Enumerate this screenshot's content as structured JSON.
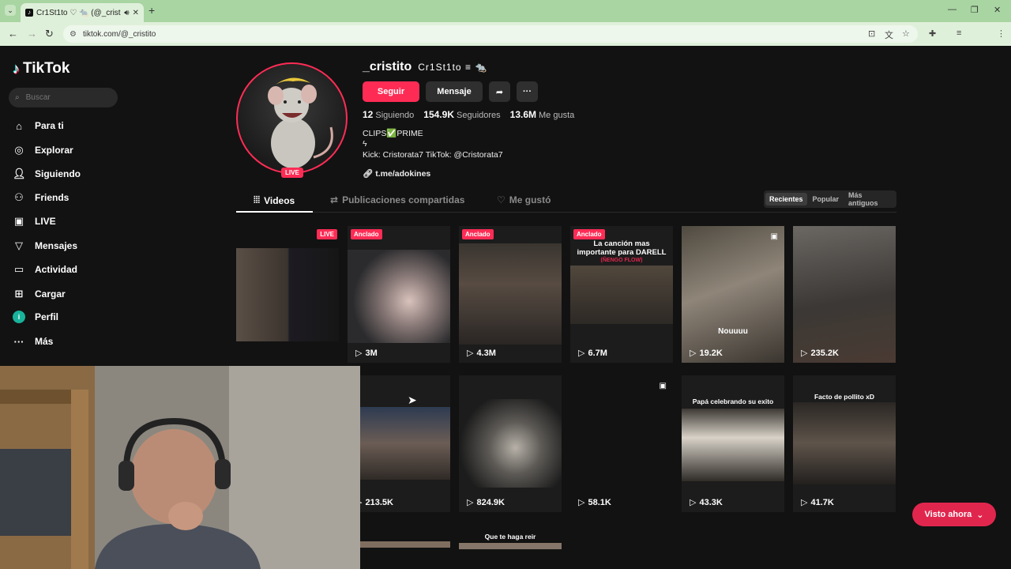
{
  "browser": {
    "tab_title": "Cr1St1to ♡ 🐀 (@_cristito",
    "url": "tiktok.com/@_cristito",
    "new_tab_icon": "plus-icon"
  },
  "sidebar": {
    "logo": "TikTok",
    "search_placeholder": "Buscar",
    "items": [
      {
        "label": "Para ti",
        "icon": "home-icon"
      },
      {
        "label": "Explorar",
        "icon": "compass-icon"
      },
      {
        "label": "Siguiendo",
        "icon": "user-follow-icon"
      },
      {
        "label": "Friends",
        "icon": "friends-icon"
      },
      {
        "label": "LIVE",
        "icon": "live-icon"
      },
      {
        "label": "Mensajes",
        "icon": "send-icon"
      },
      {
        "label": "Actividad",
        "icon": "message-icon"
      },
      {
        "label": "Cargar",
        "icon": "upload-icon"
      },
      {
        "label": "Perfil",
        "icon": "profile-avatar-icon"
      },
      {
        "label": "Más",
        "icon": "more-icon"
      }
    ],
    "profile_initial": "i"
  },
  "profile": {
    "username": "_cristito",
    "nickname": "Cr1St1to ≡ 🐀",
    "live_badge": "LIVE",
    "follow_label": "Seguir",
    "message_label": "Mensaje",
    "stats": {
      "following_count": "12",
      "following_label": "Siguiendo",
      "followers_count": "154.9K",
      "followers_label": "Seguidores",
      "likes_count": "13.6M",
      "likes_label": "Me gusta"
    },
    "bio_line1": "CLIPS✅PRIME",
    "bio_line2": "ϟ",
    "bio_line3": "Kick: Cristorata7 TikTok: @Cristorata7",
    "link": "t.me/adokines"
  },
  "content_tabs": [
    {
      "label": "Videos",
      "icon": "grid-icon"
    },
    {
      "label": "Publicaciones compartidas",
      "icon": "repost-icon"
    },
    {
      "label": "Me gustó",
      "icon": "heart-icon"
    }
  ],
  "sort_options": [
    "Recientes",
    "Popular",
    "Más antiguos"
  ],
  "videos_row1": [
    {
      "views": "",
      "badge": "LIVE"
    },
    {
      "views": "3M",
      "badge": "Anclado"
    },
    {
      "views": "4.3M",
      "badge": "Anclado"
    },
    {
      "views": "6.7M",
      "badge": "Anclado",
      "title": "La canción mas importante para DARELL",
      "subtitle": "(ÑENGO FLOW)"
    },
    {
      "views": "19.2K",
      "badge": "",
      "title": "Nouuuu"
    },
    {
      "views": "235.2K",
      "badge": ""
    }
  ],
  "videos_row2": [
    {
      "views": "213.5K"
    },
    {
      "views": "824.9K"
    },
    {
      "views": "58.1K"
    },
    {
      "views": "43.3K",
      "title": "Papá celebrando su exito"
    },
    {
      "views": "41.7K",
      "title": "Facto de pollito xD"
    }
  ],
  "videos_row3": [
    {
      "title": ""
    },
    {
      "title": "Que te haga reir"
    }
  ],
  "visto_ahora": "Visto ahora"
}
